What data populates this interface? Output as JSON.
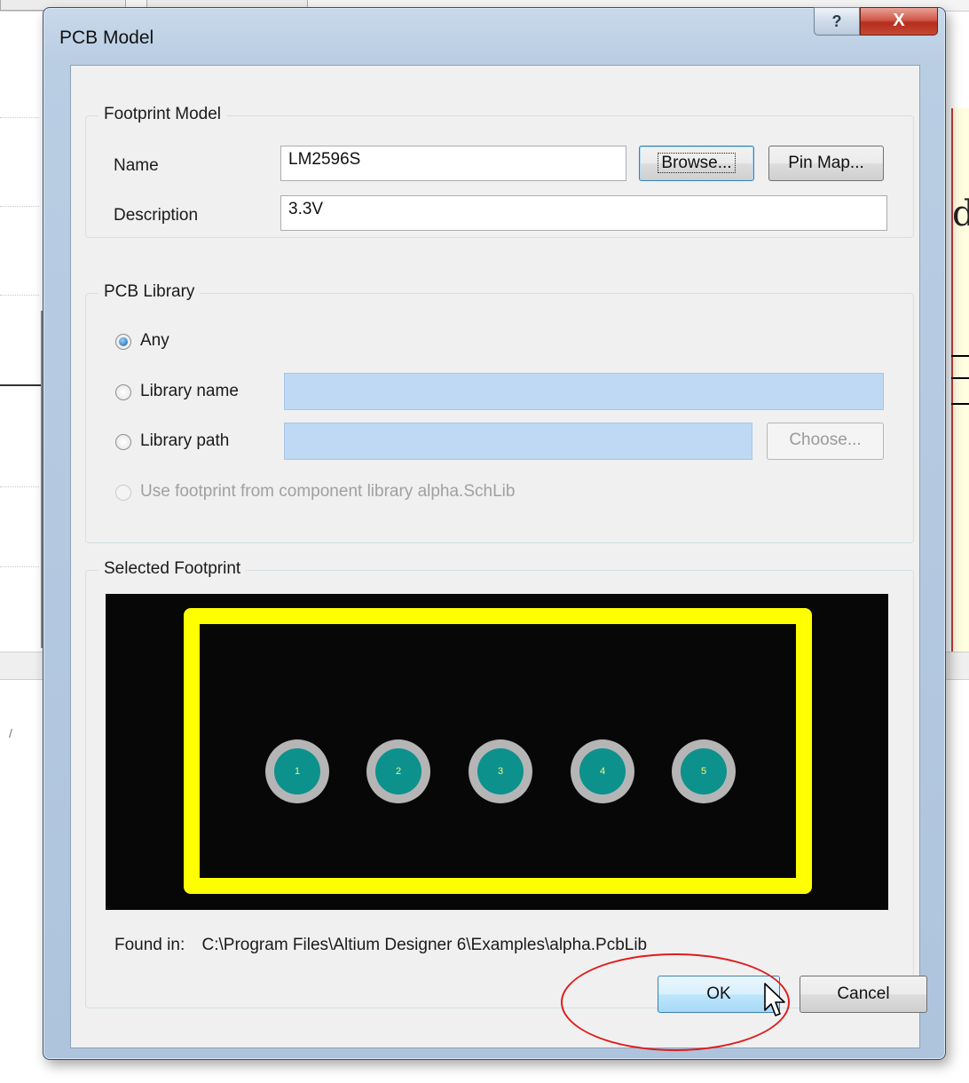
{
  "window": {
    "title": "PCB Model",
    "help_glyph": "?",
    "close_glyph": "X"
  },
  "footprint_model": {
    "legend": "Footprint Model",
    "name_label": "Name",
    "name_value": "LM2596S",
    "description_label": "Description",
    "description_value": "3.3V",
    "browse_label": "Browse...",
    "pinmap_label": "Pin Map..."
  },
  "pcb_library": {
    "legend": "PCB Library",
    "options": {
      "any": "Any",
      "library_name": "Library name",
      "library_path": "Library path",
      "use_component": "Use footprint from component library alpha.SchLib"
    },
    "selected": "Any",
    "choose_label": "Choose..."
  },
  "selected_footprint": {
    "legend": "Selected Footprint",
    "pads": [
      "1",
      "2",
      "3",
      "4",
      "5"
    ],
    "found_in_label": "Found in:",
    "found_in_path": "C:\\Program Files\\Altium Designer 6\\Examples\\alpha.PcbLib"
  },
  "buttons": {
    "ok": "OK",
    "cancel": "Cancel"
  },
  "colors": {
    "canvas": "#070707",
    "outline": "#ffff00",
    "pad_ring": "#b5b5b5",
    "pad_core": "#0d918d",
    "annotation": "#e11b1b",
    "library_fields": "#bfd8f4"
  },
  "icons": {
    "help": "help-icon",
    "close": "close-icon",
    "cursor": "mouse-cursor-icon"
  }
}
